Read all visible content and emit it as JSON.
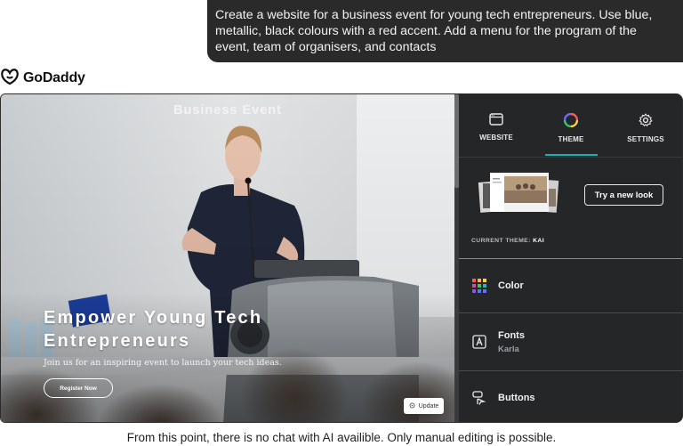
{
  "chat": {
    "prompt": "Create a website for a business event for young tech entrepreneurs. Use blue, metallic, black colours with a red accent. Add a menu for the program of the event, team of organisers, and contacts"
  },
  "brand": {
    "name": "GoDaddy"
  },
  "preview": {
    "event_title": "Business Event",
    "headline_line1": "Empower Young Tech",
    "headline_line2": "Entrepreneurs",
    "subtitle": "Join us for an inspiring event to launch your tech ideas.",
    "register_label": "Register Now",
    "update_label": "Update"
  },
  "panel": {
    "tabs": [
      {
        "label": "WEBSITE",
        "icon": "browser-window-icon"
      },
      {
        "label": "THEME",
        "icon": "color-wheel-icon",
        "active": true
      },
      {
        "label": "SETTINGS",
        "icon": "gear-icon"
      }
    ],
    "try_new_look": "Try a new look",
    "current_theme_label": "CURRENT THEME:",
    "current_theme_value": "KAI",
    "rows": [
      {
        "label": "Color",
        "icon": "color-grid-icon"
      },
      {
        "label": "Fonts",
        "sub": "Karla",
        "icon": "font-a-icon"
      },
      {
        "label": "Buttons",
        "icon": "button-icon"
      }
    ]
  },
  "footer_note": "From this point, there is no chat with AI availible. Only manual editing is possible.",
  "colors": {
    "panel_bg": "#252628",
    "accent_teal": "#1bb0b8",
    "prompt_bg": "#2a2a2a"
  }
}
